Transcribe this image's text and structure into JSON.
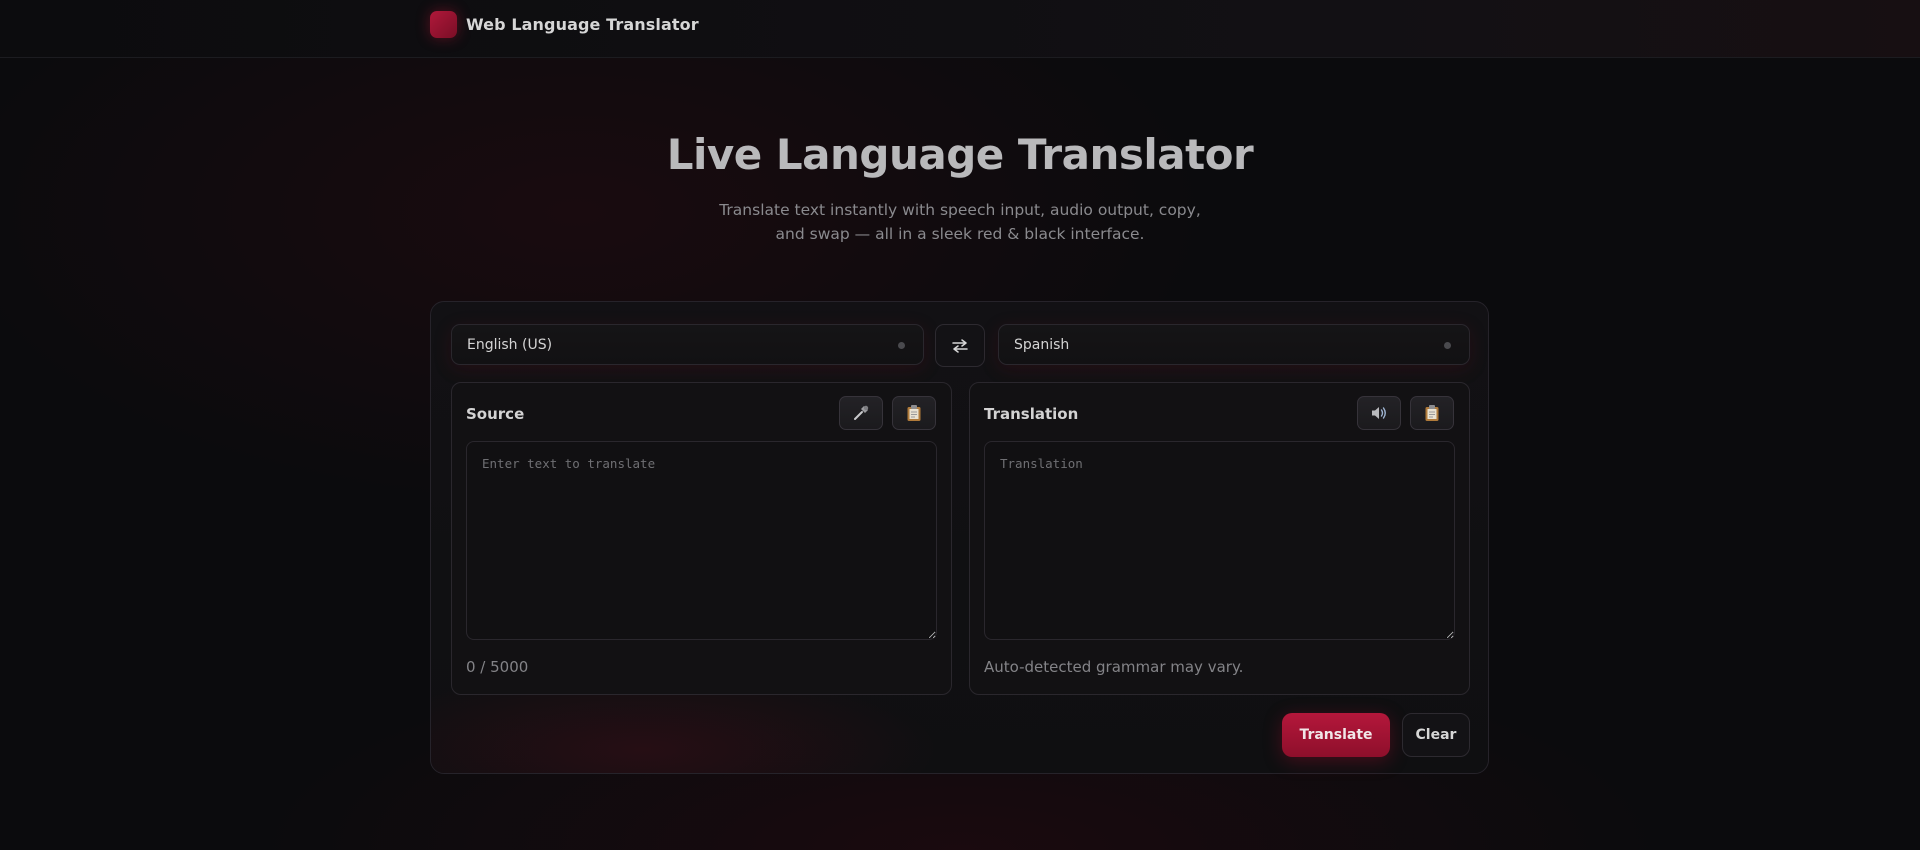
{
  "app": {
    "title": "Web Language Translator"
  },
  "hero": {
    "title": "Live Language Translator",
    "subtitle_line1": "Translate text instantly with speech input, audio output, copy,",
    "subtitle_line2": "and swap — all in a sleek red & black interface."
  },
  "languages": {
    "from": "English (US)",
    "to": "Spanish"
  },
  "source": {
    "title": "Source",
    "placeholder": "Enter text to translate",
    "value": "",
    "counter": "0 / 5000",
    "icons": [
      "microphone-icon",
      "clipboard-icon"
    ]
  },
  "translation": {
    "title": "Translation",
    "placeholder": "Translation",
    "value": "",
    "note": "Auto-detected grammar may vary.",
    "icons": [
      "speaker-icon",
      "clipboard-icon"
    ]
  },
  "actions": {
    "translate_label": "Translate",
    "clear_label": "Clear"
  },
  "colors": {
    "accent": "#a5143a",
    "background": "#0b0b0d",
    "panel": "#121113"
  }
}
